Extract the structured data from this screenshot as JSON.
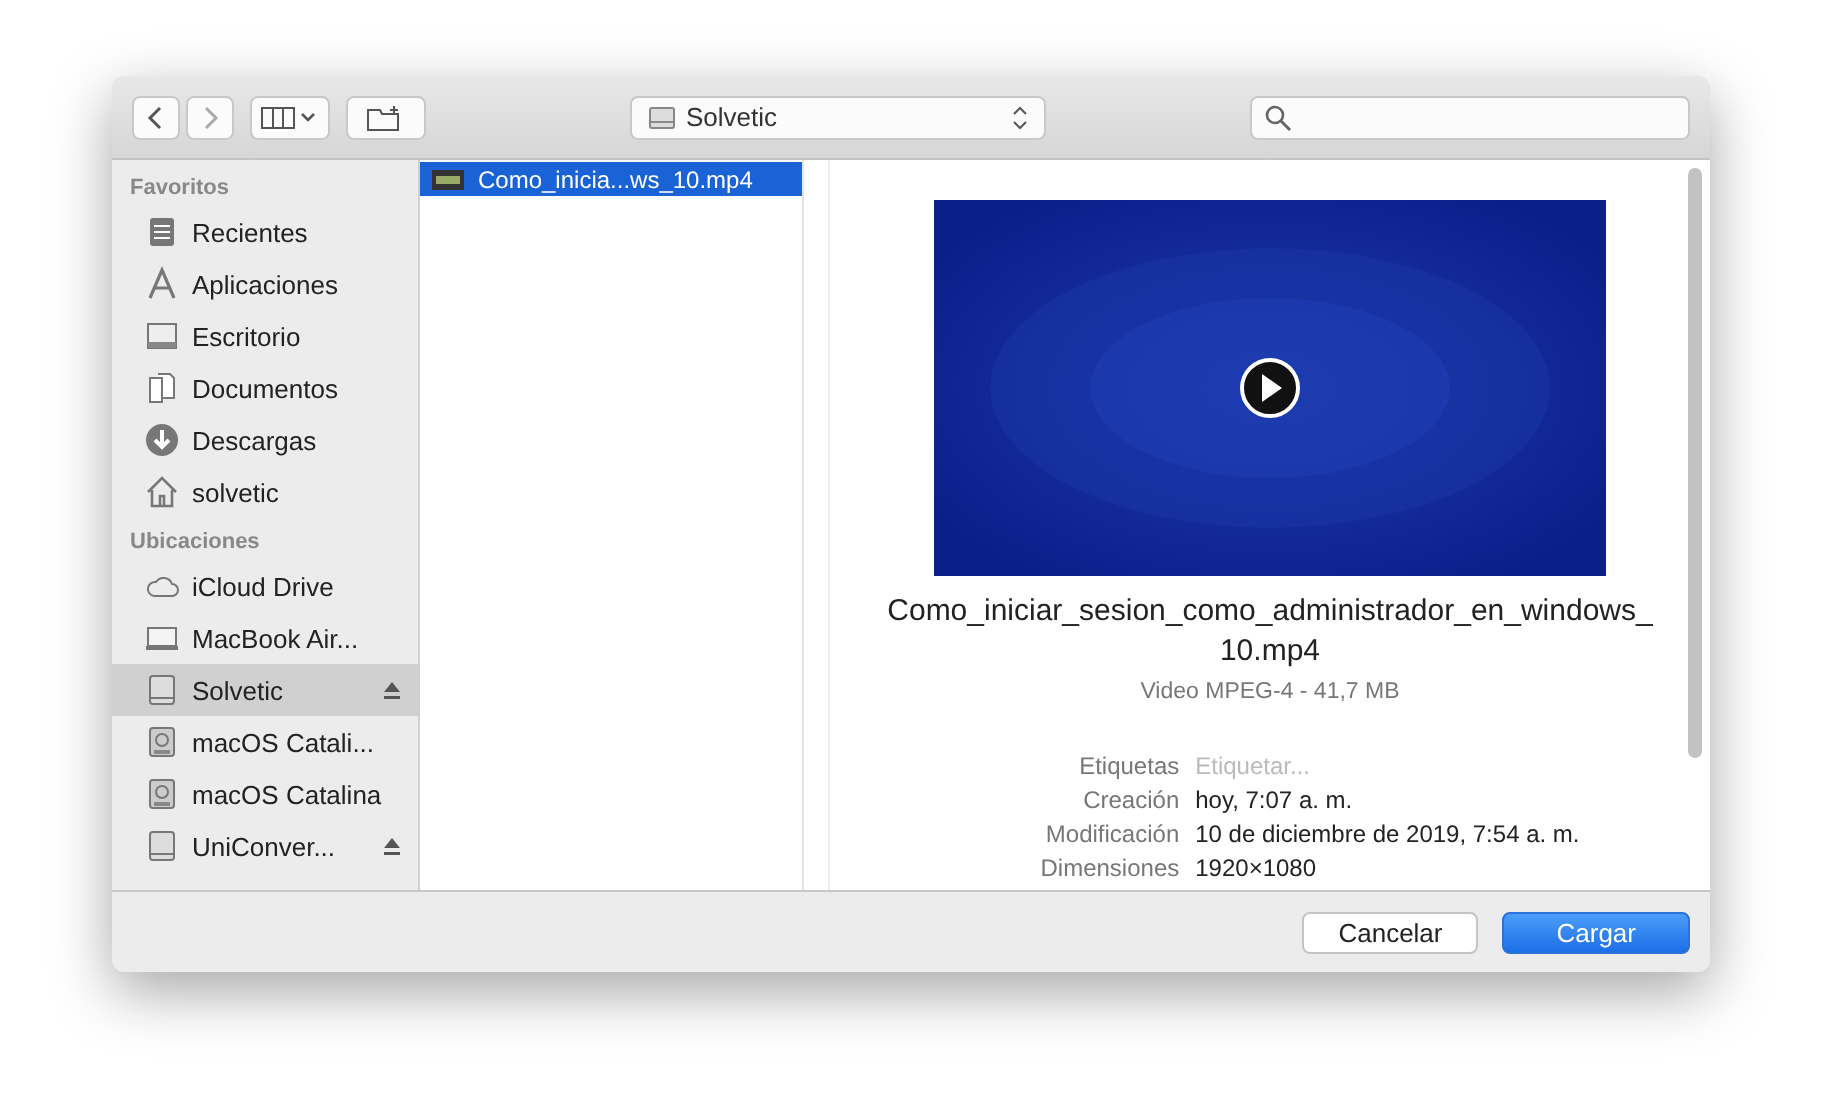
{
  "toolbar": {
    "location": "Solvetic"
  },
  "sidebar": {
    "sections": [
      {
        "title": "Favoritos",
        "items": [
          {
            "label": "Recientes",
            "selected": false,
            "eject": false
          },
          {
            "label": "Aplicaciones",
            "selected": false,
            "eject": false
          },
          {
            "label": "Escritorio",
            "selected": false,
            "eject": false
          },
          {
            "label": "Documentos",
            "selected": false,
            "eject": false
          },
          {
            "label": "Descargas",
            "selected": false,
            "eject": false
          },
          {
            "label": "solvetic",
            "selected": false,
            "eject": false
          }
        ]
      },
      {
        "title": "Ubicaciones",
        "items": [
          {
            "label": "iCloud Drive",
            "selected": false,
            "eject": false
          },
          {
            "label": "MacBook Air...",
            "selected": false,
            "eject": false
          },
          {
            "label": "Solvetic",
            "selected": true,
            "eject": true
          },
          {
            "label": "macOS Catali...",
            "selected": false,
            "eject": false
          },
          {
            "label": "macOS Catalina",
            "selected": false,
            "eject": false
          },
          {
            "label": "UniConver...",
            "selected": false,
            "eject": true
          }
        ]
      }
    ]
  },
  "files": [
    {
      "name": "Como_inicia...ws_10.mp4",
      "selected": true
    }
  ],
  "preview": {
    "kind": "picture",
    "filename": "Como_iniciar_sesion_como_administrador_en_windows_10.mp4",
    "info": "Video MPEG-4 - 41,7 MB",
    "details": [
      {
        "label": "Etiquetas",
        "placeholder": "Etiquetar..."
      },
      {
        "label": "Creación",
        "value": "hoy, 7:07 a. m."
      },
      {
        "label": "Modificación",
        "value": "10 de diciembre de 2019, 7:54 a. m."
      },
      {
        "label": "Dimensiones",
        "value": "1920×1080"
      }
    ]
  },
  "buttons": [
    {
      "label": "Cancelar",
      "default": false
    },
    {
      "label": "Cargar",
      "default": true
    }
  ]
}
